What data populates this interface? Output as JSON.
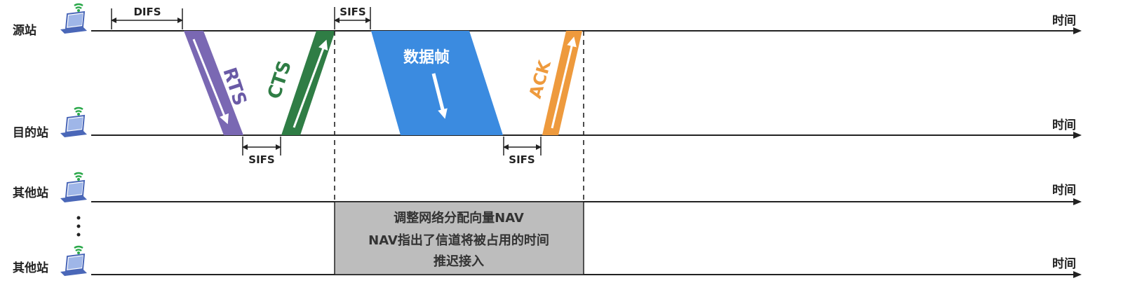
{
  "stations": [
    {
      "label": "源站",
      "axis": "时间"
    },
    {
      "label": "目的站",
      "axis": "时间"
    },
    {
      "label": "其他站",
      "axis": "时间"
    },
    {
      "label": "其他站",
      "axis": "时间"
    }
  ],
  "intervals": {
    "difs": "DIFS",
    "sifs_top": "SIFS",
    "sifs_1": "SIFS",
    "sifs_2": "SIFS"
  },
  "frames": {
    "rts": "RTS",
    "cts": "CTS",
    "data": "数据帧",
    "ack": "ACK"
  },
  "nav": {
    "line1": "调整网络分配向量NAV",
    "line2": "NAV指出了信道将被占用的时间",
    "line3": "推迟接入"
  },
  "ellipsis": "⋮",
  "colors": {
    "rts": "#7a68b3",
    "cts": "#2f7d45",
    "data": "#3b8be0",
    "ack": "#ee9a3d",
    "nav": "#bdbdbd",
    "wifi": "#2aa84a",
    "laptop": "#4a67b8"
  }
}
